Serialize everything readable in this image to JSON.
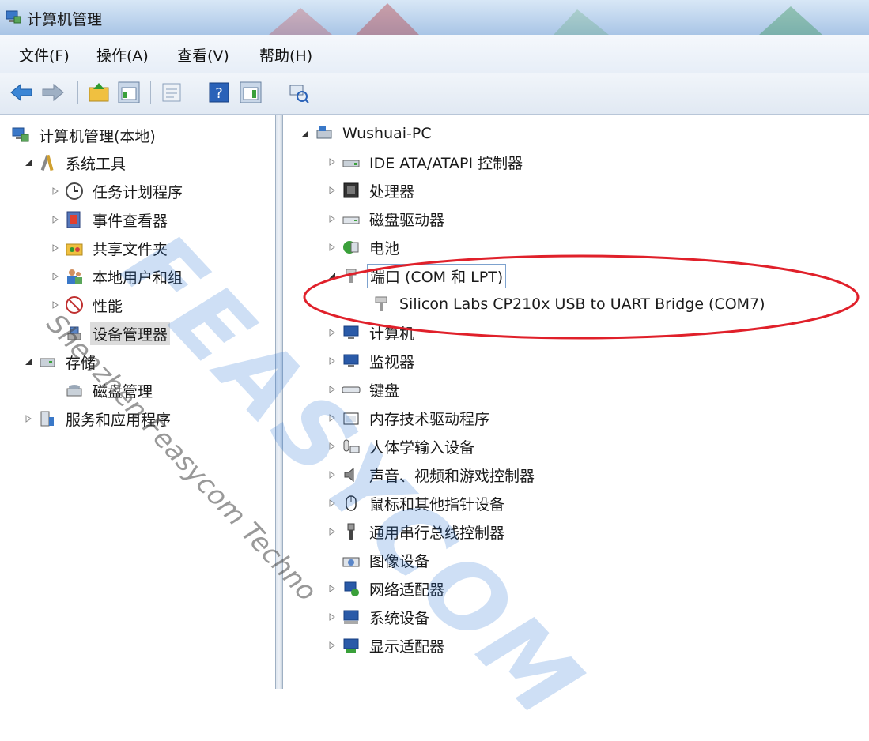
{
  "window": {
    "title": "计算机管理"
  },
  "menu": [
    "文件(F)",
    "操作(A)",
    "查看(V)",
    "帮助(H)"
  ],
  "toolbar_icons": [
    "back-arrow-icon",
    "forward-arrow-icon",
    "up-folder-icon",
    "show-tree-icon",
    "properties-icon",
    "help-icon",
    "action-pane-icon",
    "scan-hardware-icon"
  ],
  "left_tree": {
    "root": "计算机管理(本地)",
    "system_tools": "系统工具",
    "task_scheduler": "任务计划程序",
    "event_viewer": "事件查看器",
    "shared_folders": "共享文件夹",
    "local_users": "本地用户和组",
    "performance": "性能",
    "device_manager": "设备管理器",
    "storage": "存储",
    "disk_management": "磁盘管理",
    "services": "服务和应用程序"
  },
  "right_tree": {
    "computer_name": "Wushuai-PC",
    "ide": "IDE ATA/ATAPI 控制器",
    "cpu": "处理器",
    "disk": "磁盘驱动器",
    "battery": "电池",
    "ports": "端口 (COM 和 LPT)",
    "port_device": "Silicon Labs CP210x USB to UART Bridge (COM7)",
    "computer": "计算机",
    "monitor": "监视器",
    "keyboard": "键盘",
    "memory": "内存技术驱动程序",
    "hid": "人体学输入设备",
    "audio": "声音、视频和游戏控制器",
    "mouse": "鼠标和其他指针设备",
    "usb": "通用串行总线控制器",
    "imaging": "图像设备",
    "network": "网络适配器",
    "system": "系统设备",
    "display": "显示适配器"
  },
  "watermark": {
    "big": "FEASYCOM",
    "small": "Shenzhen Feasycom Techno"
  },
  "colors": {
    "highlight_circle": "#e0202a",
    "watermark_blue": "#1e6ed2",
    "selection_gray": "#dcdcdc"
  }
}
